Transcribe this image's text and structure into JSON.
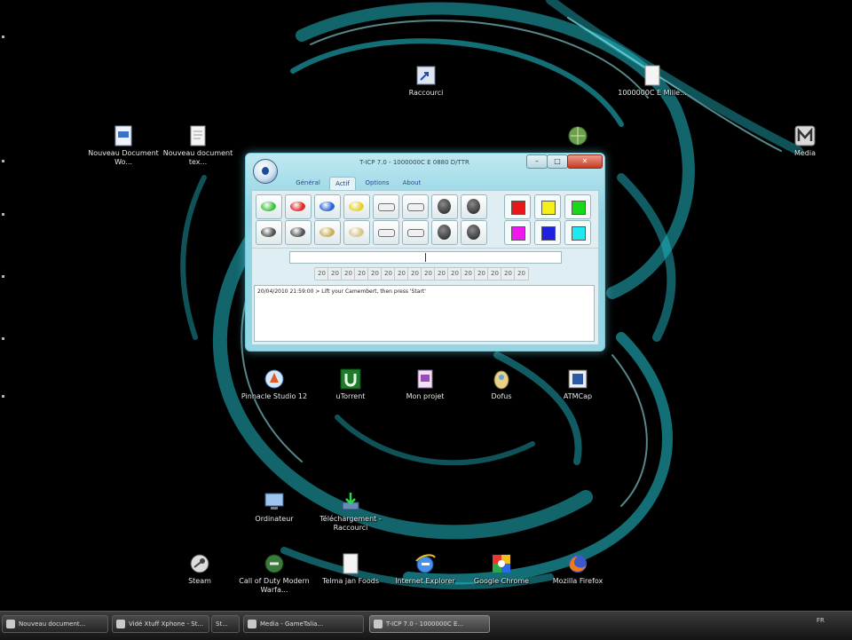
{
  "desktop": {
    "icons": [
      {
        "name": "desktop-icon-nouveau-document-1",
        "label": "Nouveau Document Wo...",
        "icon": "word-document-icon"
      },
      {
        "name": "desktop-icon-nouveau-document-2",
        "label": "Nouveau document tex...",
        "icon": "text-document-icon"
      },
      {
        "name": "desktop-icon-raccourci",
        "label": "Raccourci",
        "icon": "shortcut-icon"
      },
      {
        "name": "desktop-icon-file-top-right",
        "label": "1000000C E Mille...",
        "icon": "text-document-icon"
      },
      {
        "name": "desktop-icon-globe",
        "label": "",
        "icon": "globe-icon"
      },
      {
        "name": "desktop-icon-media",
        "label": "Media",
        "icon": "media-icon"
      },
      {
        "name": "desktop-icon-pinnacle",
        "label": "Pinnacle Studio 12",
        "icon": "pinnacle-icon"
      },
      {
        "name": "desktop-icon-utorrent",
        "label": "uTorrent",
        "icon": "utorrent-icon"
      },
      {
        "name": "desktop-icon-mon-projet",
        "label": "Mon projet",
        "icon": "project-icon"
      },
      {
        "name": "desktop-icon-dofus",
        "label": "Dofus",
        "icon": "dofus-icon"
      },
      {
        "name": "desktop-icon-atmcap",
        "label": "ATMCap",
        "icon": "app-icon"
      },
      {
        "name": "desktop-icon-ordinateur",
        "label": "Ordinateur",
        "icon": "computer-icon"
      },
      {
        "name": "desktop-icon-telechargement",
        "label": "Téléchargement - Raccourci",
        "icon": "download-icon"
      },
      {
        "name": "desktop-icon-steam",
        "label": "Steam",
        "icon": "steam-icon"
      },
      {
        "name": "desktop-icon-call-of-duty",
        "label": "Call of Duty Modern Warfa...",
        "icon": "cod-icon"
      },
      {
        "name": "desktop-icon-telma",
        "label": "Telma jan Foods",
        "icon": "text-document-icon"
      },
      {
        "name": "desktop-icon-ie",
        "label": "Internet Explorer",
        "icon": "internet-explorer-icon"
      },
      {
        "name": "desktop-icon-chrome",
        "label": "Google Chrome",
        "icon": "chrome-icon"
      },
      {
        "name": "desktop-icon-firefox",
        "label": "Mozilla Firefox",
        "icon": "firefox-icon"
      }
    ]
  },
  "window": {
    "title": "T-ICP 7.0 - 1000000C E 0880 D/TTR",
    "minimize": "–",
    "maximize": "□",
    "close": "✕",
    "tabs": [
      {
        "label": "Général"
      },
      {
        "label": "Actif"
      },
      {
        "label": "Options"
      },
      {
        "label": "About"
      }
    ],
    "active_tab": "Actif",
    "tools": [
      {
        "name": "tool-green-pill",
        "color": "#3ec43e",
        "shape": "pill"
      },
      {
        "name": "tool-red-pill",
        "color": "#e02a2a",
        "shape": "pill"
      },
      {
        "name": "tool-blue-pill",
        "color": "#2a66d8",
        "shape": "pill"
      },
      {
        "name": "tool-yellow-pill",
        "color": "#e4d22a",
        "shape": "pill"
      },
      {
        "name": "tool-flat-1",
        "color": "#f0f0f0",
        "shape": "flat"
      },
      {
        "name": "tool-flat-2",
        "color": "#f0f0f0",
        "shape": "flat"
      },
      {
        "name": "tool-dark-round-1",
        "color": "#222222",
        "shape": "round"
      },
      {
        "name": "tool-dark-round-2",
        "color": "#222222",
        "shape": "round"
      },
      {
        "name": "tool-gray-pill-1",
        "color": "#555555",
        "shape": "pill"
      },
      {
        "name": "tool-gray-pill-2",
        "color": "#555555",
        "shape": "pill"
      },
      {
        "name": "tool-brush",
        "color": "#c8b060",
        "shape": "pill"
      },
      {
        "name": "tool-pencil",
        "color": "#d4c890",
        "shape": "pill"
      },
      {
        "name": "tool-flat-3",
        "color": "#f0f0f0",
        "shape": "flat"
      },
      {
        "name": "tool-flat-4",
        "color": "#f0f0f0",
        "shape": "flat"
      },
      {
        "name": "tool-dark-round-3",
        "color": "#222222",
        "shape": "round"
      },
      {
        "name": "tool-dark-round-4",
        "color": "#222222",
        "shape": "round"
      }
    ],
    "colors": [
      {
        "name": "color-red",
        "hex": "#e81818"
      },
      {
        "name": "color-yellow",
        "hex": "#f4f018"
      },
      {
        "name": "color-green",
        "hex": "#18d818"
      },
      {
        "name": "color-magenta",
        "hex": "#f018f0"
      },
      {
        "name": "color-blue",
        "hex": "#2020e0"
      },
      {
        "name": "color-cyan",
        "hex": "#20e8f0"
      }
    ],
    "input_value": "",
    "number_cells": [
      "20",
      "20",
      "20",
      "20",
      "20",
      "20",
      "20",
      "20",
      "20",
      "20",
      "20",
      "20",
      "20",
      "20",
      "20",
      "20"
    ],
    "log_line": "20/04/2010 21:59:00 > Lift your Camembert, then press 'Start'"
  },
  "taskbar": {
    "tasks": [
      {
        "name": "task-nouveau-document",
        "label": "Nouveau document..."
      },
      {
        "name": "task-video-xtuff",
        "label": "Vidé Xtuff Xphone - St..."
      },
      {
        "name": "task-st",
        "label": "St..."
      },
      {
        "name": "task-media",
        "label": "Media - GameTalia..."
      },
      {
        "name": "task-ticp",
        "label": "T-ICP 7.0 - 1000000C E..."
      }
    ],
    "active_task": "task-ticp",
    "tray": {
      "lang": "FR"
    }
  },
  "theme": {
    "desktop_bg": "#000000",
    "swirl": "#2fd6e0",
    "window_frame": "#93d6e4"
  }
}
